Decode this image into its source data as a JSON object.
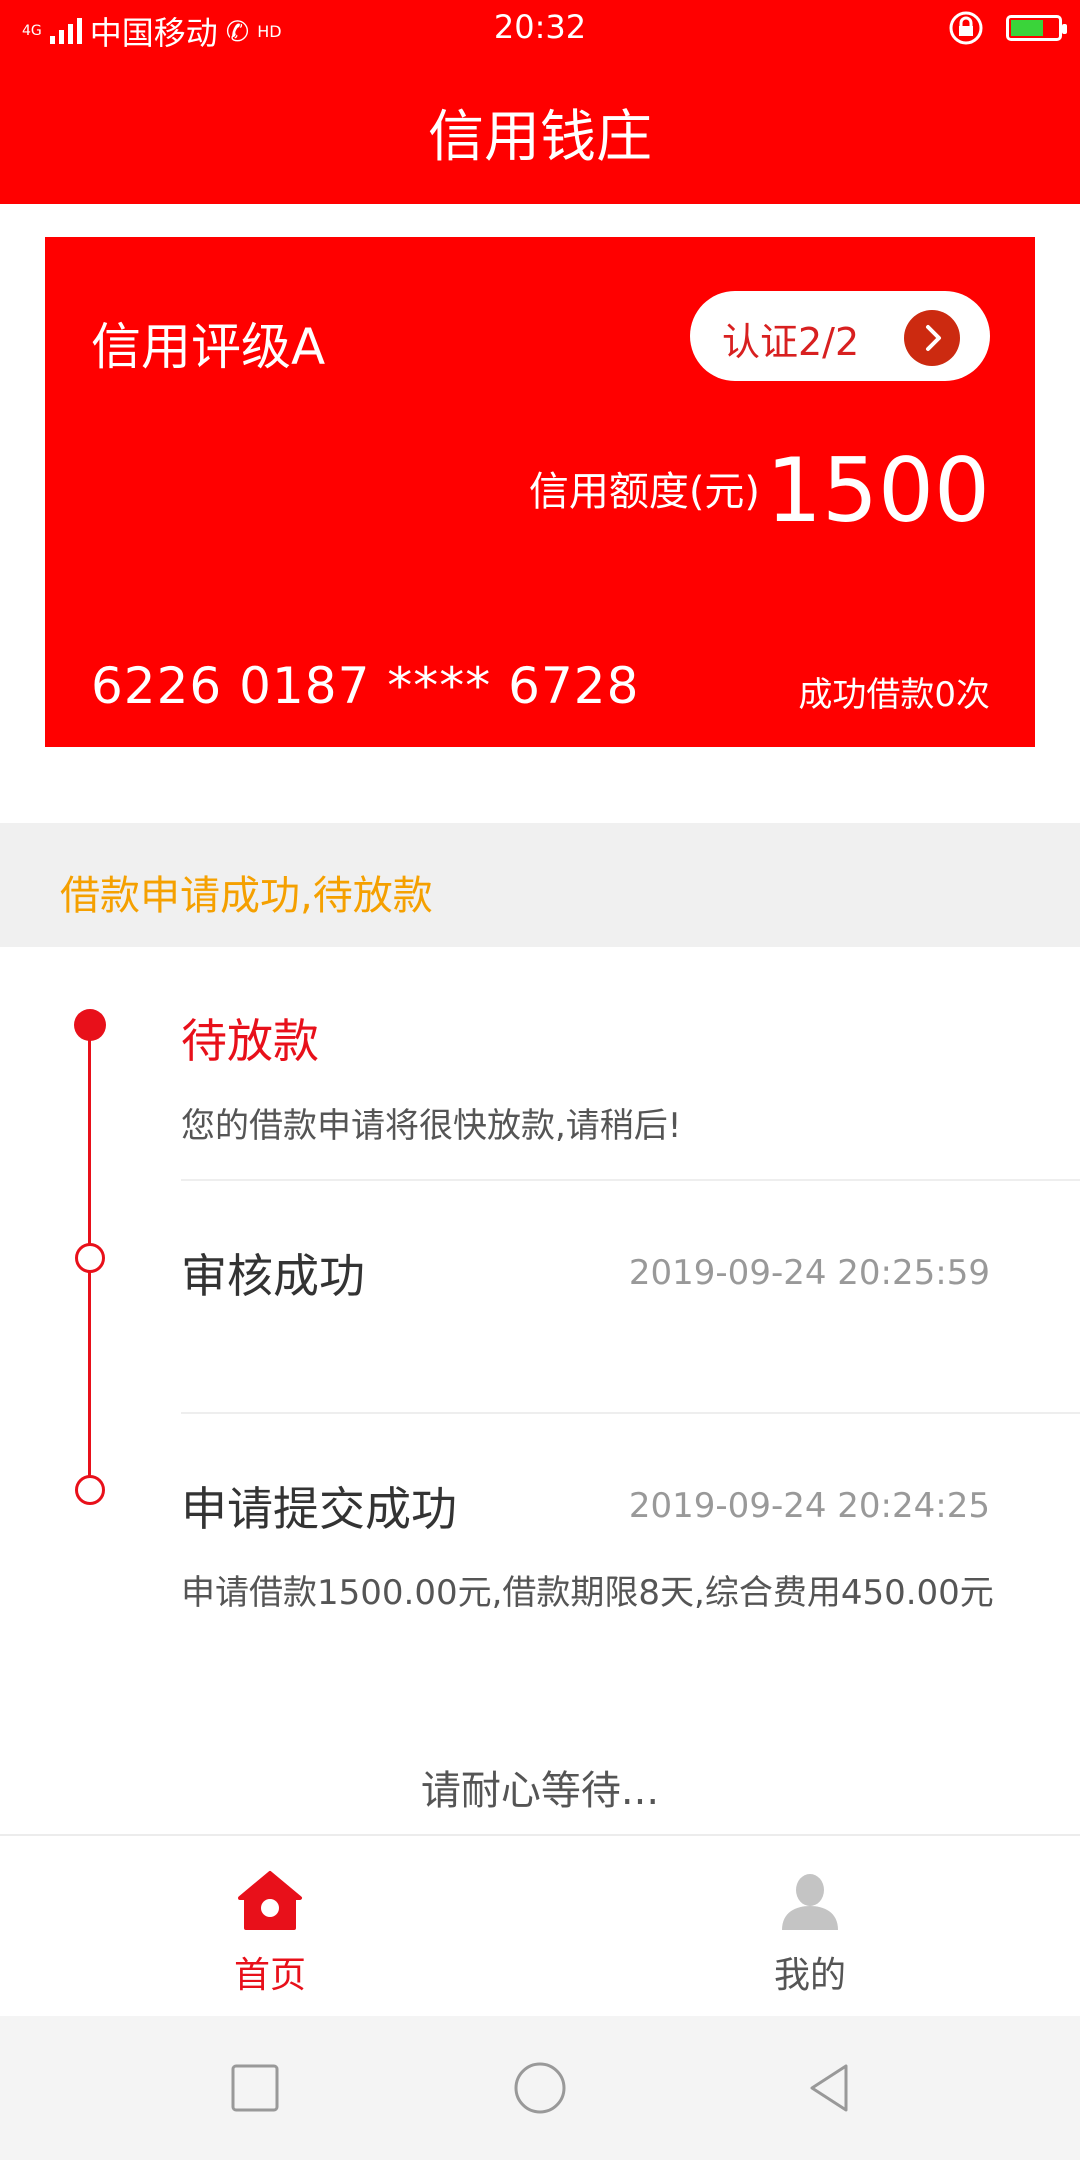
{
  "status_bar": {
    "network": "4G",
    "carrier": "中国移动",
    "hd": "HD",
    "time": "20:32"
  },
  "header": {
    "title": "信用钱庄"
  },
  "card": {
    "rating": "信用评级A",
    "cert_label": "认证2/2",
    "limit_label": "信用额度(元)",
    "limit_value": "1500",
    "card_number": "6226 0187 **** 6728",
    "success_count": "成功借款0次"
  },
  "notice": "借款申请成功,待放款",
  "timeline": [
    {
      "title": "待放款",
      "desc": "您的借款申请将很快放款,请稍后!",
      "time": ""
    },
    {
      "title": "审核成功",
      "desc": "",
      "time": "2019-09-24 20:25:59"
    },
    {
      "title": "申请提交成功",
      "desc": "申请借款1500.00元,借款期限8天,综合费用450.00元",
      "time": "2019-09-24 20:24:25"
    }
  ],
  "waiting_text": "请耐心等待...",
  "tabs": [
    {
      "label": "首页",
      "icon": "home-icon",
      "active": true
    },
    {
      "label": "我的",
      "icon": "user-icon",
      "active": false
    }
  ],
  "colors": {
    "brand": "#ff0000",
    "accent": "#e8101a",
    "notice": "#f5a000"
  }
}
